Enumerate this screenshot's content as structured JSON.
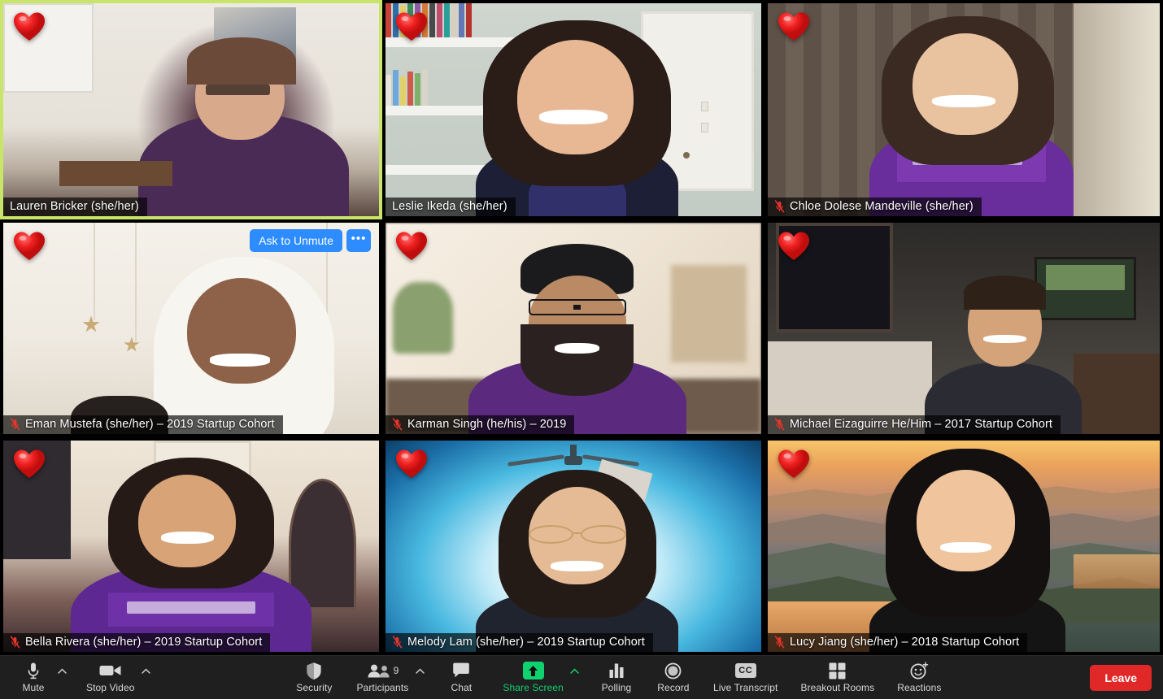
{
  "app": {
    "name": "Zoom",
    "view": "Gallery View",
    "participant_count": "9"
  },
  "tiles": [
    {
      "name": "Lauren Bricker (she/her)",
      "display_name": "Lauren Bricker",
      "pronouns": "(she/her)",
      "cohort": "",
      "muted": false,
      "active_speaker": true,
      "reaction": "heart-reaction",
      "reaction_emoji": "❤️",
      "has_ask_to_unmute": false,
      "scene": "office-whiteboard"
    },
    {
      "name": "Leslie Ikeda (she/her)",
      "display_name": "Leslie Ikeda",
      "pronouns": "(she/her)",
      "cohort": "",
      "muted": false,
      "active_speaker": false,
      "reaction": "heart-reaction",
      "reaction_emoji": "❤️",
      "has_ask_to_unmute": false,
      "scene": "bookshelf-door"
    },
    {
      "name": "Chloe Dolese Mandeville (she/her)",
      "display_name": "Chloe Dolese Mandeville",
      "pronouns": "(she/her)",
      "cohort": "",
      "muted": true,
      "active_speaker": false,
      "reaction": "heart-reaction",
      "reaction_emoji": "❤️",
      "has_ask_to_unmute": false,
      "scene": "curtain-room"
    },
    {
      "name": "Eman Mustefa (she/her) – 2019 Startup Cohort",
      "display_name": "Eman Mustefa",
      "pronouns": "(she/her)",
      "cohort": "– 2019 Startup Cohort",
      "muted": true,
      "active_speaker": false,
      "reaction": "heart-reaction",
      "reaction_emoji": "❤️",
      "has_ask_to_unmute": true,
      "ask_to_unmute_label": "Ask to Unmute",
      "more_label": "•••",
      "scene": "light-wall-stars"
    },
    {
      "name": "Karman Singh (he/his) – 2019",
      "display_name": "Karman Singh",
      "pronouns": "(he/his)",
      "cohort": "– 2019",
      "muted": true,
      "active_speaker": false,
      "reaction": "heart-reaction",
      "reaction_emoji": "❤️",
      "has_ask_to_unmute": false,
      "scene": "warm-room"
    },
    {
      "name": "Michael Eizaguirre He/Him – 2017 Startup Cohort",
      "display_name": "Michael Eizaguirre",
      "pronouns": "He/Him",
      "cohort": "– 2017 Startup Cohort",
      "muted": true,
      "active_speaker": false,
      "reaction": "heart-reaction",
      "reaction_emoji": "❤️",
      "has_ask_to_unmute": false,
      "scene": "dark-room-mirror"
    },
    {
      "name": "Bella Rivera (she/her) – 2019 Startup Cohort",
      "display_name": "Bella Rivera",
      "pronouns": "(she/her)",
      "cohort": "– 2019 Startup Cohort",
      "muted": true,
      "active_speaker": false,
      "reaction": "heart-reaction",
      "reaction_emoji": "❤️",
      "has_ask_to_unmute": false,
      "scene": "purple-room"
    },
    {
      "name": "Melody Lam (she/her) – 2019 Startup Cohort",
      "display_name": "Melody Lam",
      "pronouns": "(she/her)",
      "cohort": "– 2019 Startup Cohort",
      "muted": true,
      "active_speaker": false,
      "reaction": "heart-reaction",
      "reaction_emoji": "❤️",
      "has_ask_to_unmute": false,
      "scene": "blue-gradient-fan"
    },
    {
      "name": "Lucy Jiang (she/her) – 2018 Startup Cohort",
      "display_name": "Lucy Jiang",
      "pronouns": "(she/her)",
      "cohort": "– 2018 Startup Cohort",
      "muted": true,
      "active_speaker": false,
      "reaction": "heart-reaction",
      "reaction_emoji": "❤️",
      "has_ask_to_unmute": false,
      "scene": "sunset-mountains"
    }
  ],
  "toolbar": {
    "mute": {
      "label": "Mute",
      "icon": "microphone-icon",
      "has_caret": true
    },
    "video": {
      "label": "Stop Video",
      "icon": "video-camera-icon",
      "has_caret": true
    },
    "security": {
      "label": "Security",
      "icon": "shield-icon",
      "has_caret": false
    },
    "participants": {
      "label": "Participants",
      "icon": "people-icon",
      "count": "9",
      "has_caret": true
    },
    "chat": {
      "label": "Chat",
      "icon": "speech-bubble-icon",
      "has_caret": false
    },
    "share_screen": {
      "label": "Share Screen",
      "icon": "share-screen-up-arrow-icon",
      "has_caret": true,
      "accent": true
    },
    "polling": {
      "label": "Polling",
      "icon": "bar-chart-icon",
      "has_caret": false
    },
    "record": {
      "label": "Record",
      "icon": "record-circle-icon",
      "has_caret": false
    },
    "live_transcript": {
      "label": "Live Transcript",
      "icon": "cc-icon",
      "has_caret": false
    },
    "breakout_rooms": {
      "label": "Breakout Rooms",
      "icon": "grid-squares-icon",
      "has_caret": false
    },
    "reactions": {
      "label": "Reactions",
      "icon": "smiley-plus-icon",
      "has_caret": false
    },
    "leave": {
      "label": "Leave"
    }
  },
  "colors": {
    "accent_green": "#10d16f",
    "leave_red": "#e02828",
    "zoom_blue": "#2d8cff",
    "active_speaker_border": "#c8e56a",
    "toolbar_bg": "#1f1f1f",
    "mute_red": "#e8342a"
  }
}
